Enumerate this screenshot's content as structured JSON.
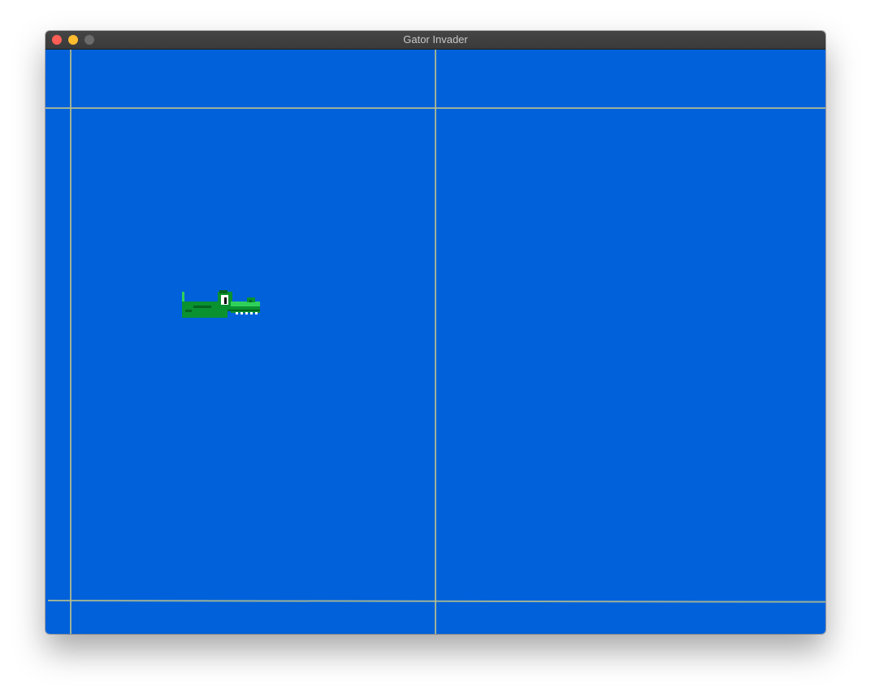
{
  "window": {
    "title": "Gator Invader",
    "traffic_lights": {
      "close_color": "#ff5f57",
      "minimize_color": "#febc2e",
      "zoom_color": "#6b6b6b"
    }
  },
  "game": {
    "background_color": "#0061DB",
    "gridline_color": "#b7c08c",
    "player_sprite": "gator",
    "gator_colors": {
      "body": "#0a9130",
      "highlight": "#2fd15a",
      "dark": "#05641f",
      "eye": "#ffffff",
      "pupil": "#000000",
      "teeth": "#ffffff"
    }
  }
}
